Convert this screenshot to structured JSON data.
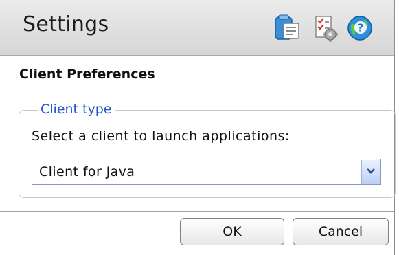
{
  "dialog": {
    "title": "Settings",
    "header_icons": [
      "application-window-icon",
      "settings-checklist-icon",
      "help-icon"
    ]
  },
  "section": {
    "title": "Client Preferences"
  },
  "client_type": {
    "legend": "Client type",
    "prompt": "Select a client to launch applications:",
    "selected": "Client for Java"
  },
  "buttons": {
    "ok": "OK",
    "cancel": "Cancel"
  },
  "colors": {
    "legend_text": "#2456c8",
    "header_bg": "#e0e0e0"
  }
}
